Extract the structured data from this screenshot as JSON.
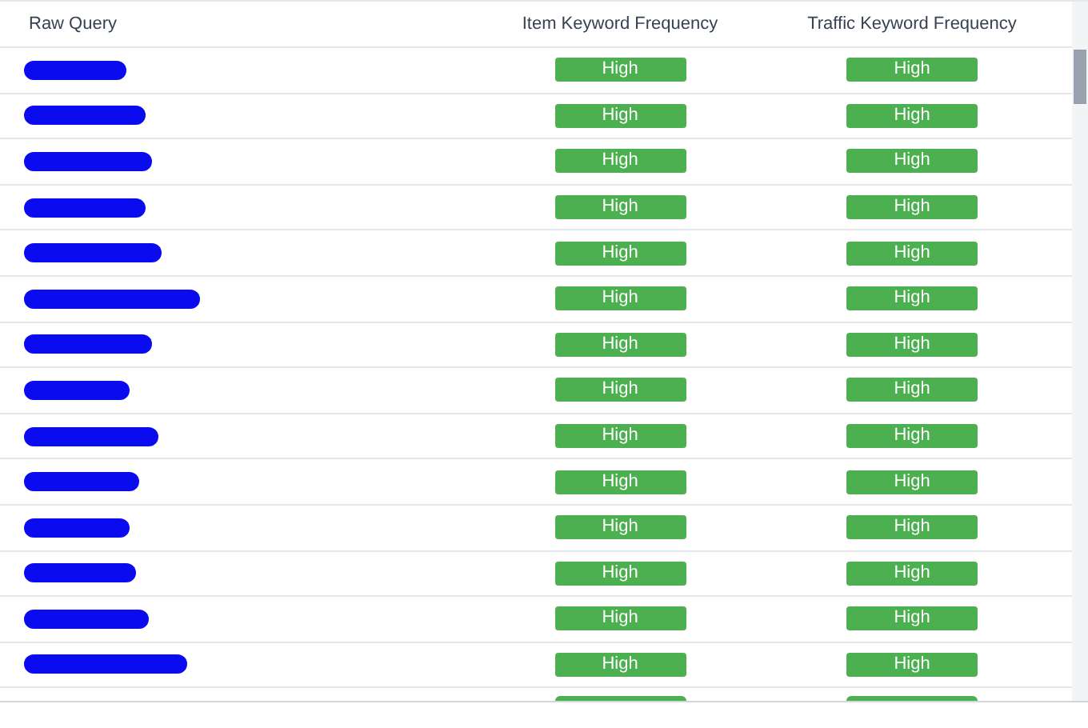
{
  "table": {
    "columns": [
      "Raw Query",
      "Item Keyword Frequency",
      "Traffic Keyword Frequency"
    ],
    "rows": [
      {
        "item_keyword_frequency": "High",
        "traffic_keyword_frequency": "High"
      },
      {
        "item_keyword_frequency": "High",
        "traffic_keyword_frequency": "High"
      },
      {
        "item_keyword_frequency": "High",
        "traffic_keyword_frequency": "High"
      },
      {
        "item_keyword_frequency": "High",
        "traffic_keyword_frequency": "High"
      },
      {
        "item_keyword_frequency": "High",
        "traffic_keyword_frequency": "High"
      },
      {
        "item_keyword_frequency": "High",
        "traffic_keyword_frequency": "High"
      },
      {
        "item_keyword_frequency": "High",
        "traffic_keyword_frequency": "High"
      },
      {
        "item_keyword_frequency": "High",
        "traffic_keyword_frequency": "High"
      },
      {
        "item_keyword_frequency": "High",
        "traffic_keyword_frequency": "High"
      },
      {
        "item_keyword_frequency": "High",
        "traffic_keyword_frequency": "High"
      },
      {
        "item_keyword_frequency": "High",
        "traffic_keyword_frequency": "High"
      },
      {
        "item_keyword_frequency": "High",
        "traffic_keyword_frequency": "High"
      },
      {
        "item_keyword_frequency": "High",
        "traffic_keyword_frequency": "High"
      },
      {
        "item_keyword_frequency": "High",
        "traffic_keyword_frequency": "High"
      }
    ]
  }
}
